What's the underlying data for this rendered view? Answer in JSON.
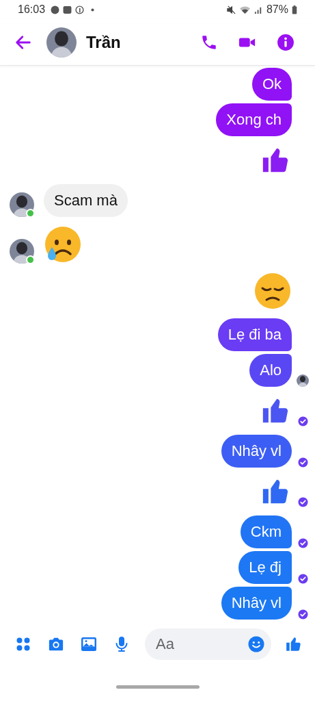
{
  "status_bar": {
    "time": "16:03",
    "battery": "87%"
  },
  "header": {
    "title": "Trần"
  },
  "messages": [
    {
      "mine": true,
      "kind": "text",
      "text": "Ok",
      "color": "#9012f5"
    },
    {
      "mine": true,
      "kind": "text",
      "text": "Xong ch",
      "color": "#9012f5"
    },
    {
      "mine": true,
      "kind": "like",
      "color": "#8a1df2"
    },
    {
      "mine": false,
      "kind": "text",
      "text": "Scam  mà",
      "online": true
    },
    {
      "mine": false,
      "kind": "teary",
      "online": true
    },
    {
      "mine": true,
      "kind": "pensive"
    },
    {
      "mine": true,
      "kind": "text",
      "text": "Lẹ đi ba",
      "color": "#6a3cf4"
    },
    {
      "mine": true,
      "kind": "text",
      "text": "Alo",
      "color": "#5a47f4",
      "seen": true
    },
    {
      "mine": true,
      "kind": "like",
      "color": "#4b55f2",
      "delivered": true
    },
    {
      "mine": true,
      "kind": "text",
      "text": "Nhây vl",
      "color": "#3d5ef4",
      "delivered": true
    },
    {
      "mine": true,
      "kind": "like",
      "color": "#2f68f2",
      "delivered": true
    },
    {
      "mine": true,
      "kind": "text",
      "text": "Ckm",
      "color": "#2174f4",
      "delivered": true
    },
    {
      "mine": true,
      "kind": "text",
      "text": "Lẹ đj",
      "color": "#1e77f4",
      "delivered": true
    },
    {
      "mine": true,
      "kind": "text",
      "text": "Nhây vl",
      "color": "#1b79f3",
      "delivered": true
    }
  ],
  "composer": {
    "placeholder": "Aa"
  }
}
